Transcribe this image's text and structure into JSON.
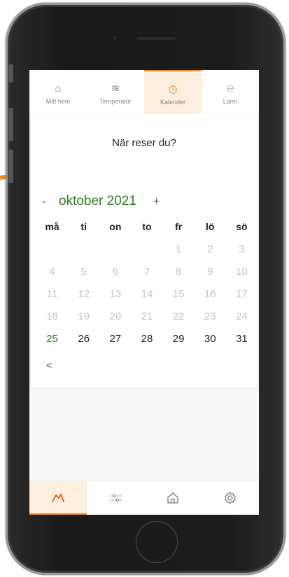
{
  "topnav": {
    "tabs": [
      {
        "label": "Mitt hem",
        "icon": "home-icon",
        "glyph": "⌂"
      },
      {
        "label": "Temperatur",
        "icon": "heat-waves-icon",
        "glyph": "≋"
      },
      {
        "label": "Kalender",
        "icon": "clock-icon",
        "glyph": "◷"
      },
      {
        "label": "Larm",
        "icon": "bell-icon",
        "glyph": "⍾"
      }
    ],
    "active": "Kalender"
  },
  "calendar": {
    "question": "När reser du?",
    "prev_label": "-",
    "month_label": "oktober 2021",
    "next_label": "+",
    "weekdays": [
      "må",
      "ti",
      "on",
      "to",
      "fr",
      "lö",
      "sö"
    ],
    "weeks": [
      [
        "",
        "",
        "",
        "",
        "1",
        "2",
        "3"
      ],
      [
        "4",
        "5",
        "6",
        "7",
        "8",
        "9",
        "10"
      ],
      [
        "11",
        "12",
        "13",
        "14",
        "15",
        "16",
        "17"
      ],
      [
        "18",
        "19",
        "20",
        "21",
        "22",
        "23",
        "24"
      ],
      [
        "25",
        "26",
        "27",
        "28",
        "29",
        "30",
        "31"
      ]
    ],
    "today": "25",
    "back_label": "<"
  },
  "bottomnav": {
    "tabs": [
      {
        "icon": "gauge-icon"
      },
      {
        "icon": "sliders-icon"
      },
      {
        "icon": "home-icon"
      },
      {
        "icon": "gear-icon"
      }
    ]
  },
  "colors": {
    "accent": "#f08a2c",
    "accent_bg": "#fdeedd",
    "month_green": "#2f7d1e",
    "muted_day": "#c4c4c4"
  }
}
